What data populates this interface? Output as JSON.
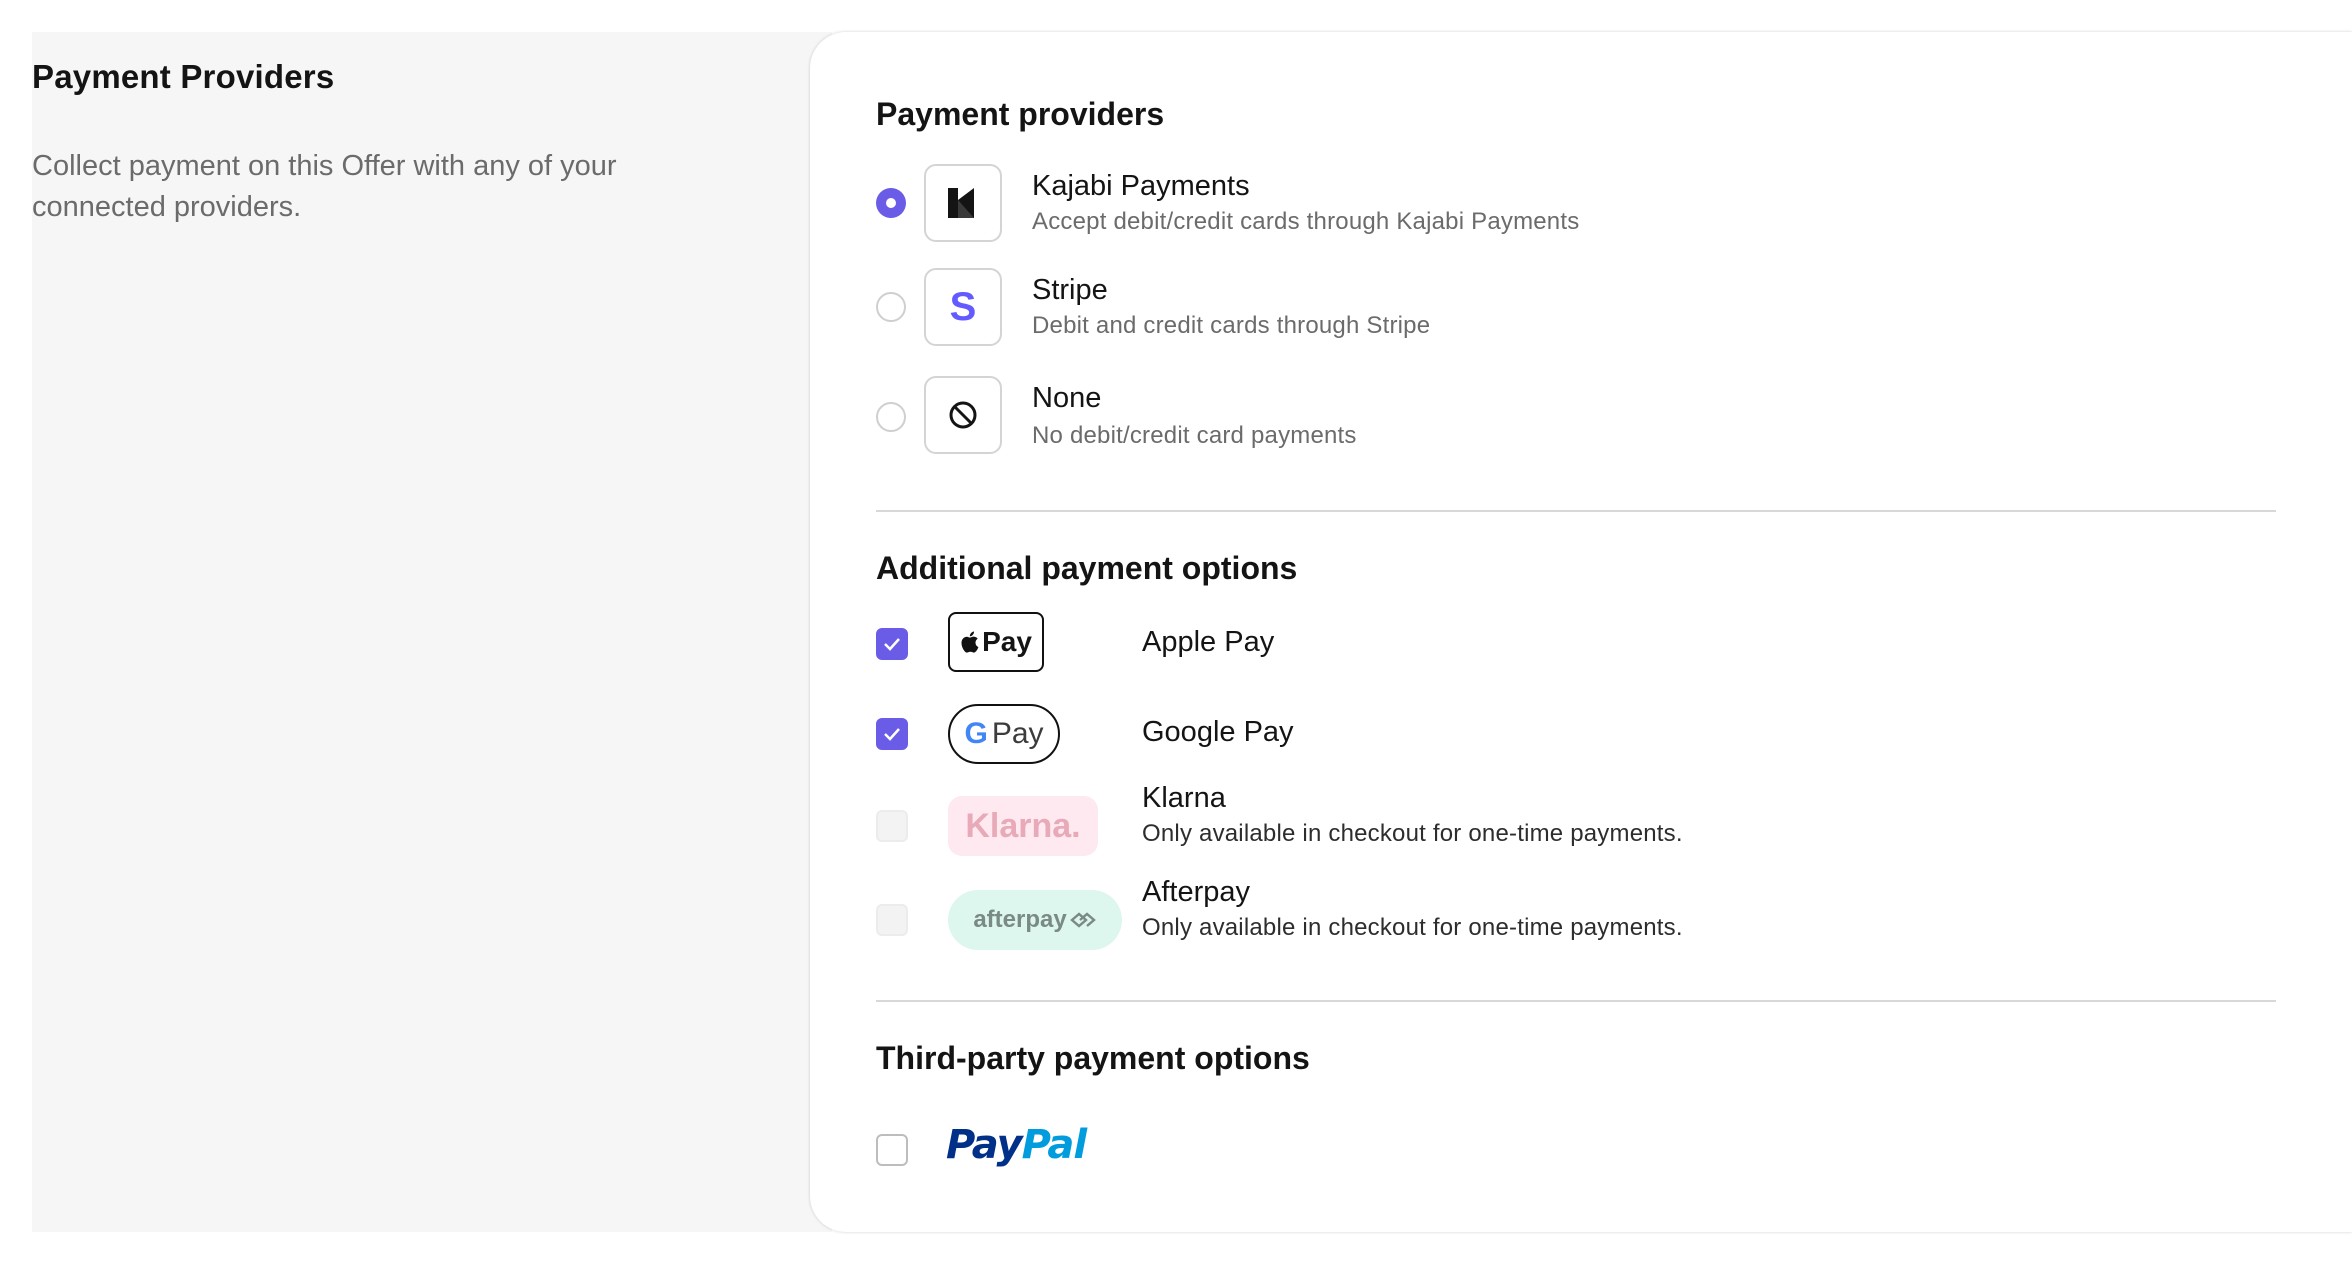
{
  "left": {
    "title": "Payment Providers",
    "description": "Collect payment on this Offer with any of your connected providers."
  },
  "providers": {
    "title": "Payment providers",
    "selected": "kajabi",
    "items": [
      {
        "id": "kajabi",
        "name": "Kajabi Payments",
        "description": "Accept debit/credit cards through Kajabi Payments",
        "icon": "kajabi-logo-icon"
      },
      {
        "id": "stripe",
        "name": "Stripe",
        "description": "Debit and credit cards through Stripe",
        "icon": "stripe-logo-icon",
        "icon_glyph": "S"
      },
      {
        "id": "none",
        "name": "None",
        "description": "No debit/credit card payments",
        "icon": "prohibited-icon"
      }
    ]
  },
  "additional": {
    "title": "Additional payment options",
    "items": [
      {
        "id": "apple-pay",
        "name": "Apple Pay",
        "checked": true,
        "enabled": true,
        "badge_text": "Pay",
        "icon": "apple-icon"
      },
      {
        "id": "google-pay",
        "name": "Google Pay",
        "checked": true,
        "enabled": true,
        "badge_g": "G",
        "badge_text": "Pay"
      },
      {
        "id": "klarna",
        "name": "Klarna",
        "checked": false,
        "enabled": false,
        "badge_text": "Klarna.",
        "note": "Only available in checkout for one-time payments."
      },
      {
        "id": "afterpay",
        "name": "Afterpay",
        "checked": false,
        "enabled": false,
        "badge_text": "afterpay",
        "note": "Only available in checkout for one-time payments."
      }
    ]
  },
  "third_party": {
    "title": "Third-party payment options",
    "items": [
      {
        "id": "paypal",
        "checked": false,
        "logo_pay": "Pay",
        "logo_pal": "Pal"
      }
    ]
  },
  "colors": {
    "accent": "#6b5ce7",
    "stripe": "#635bff",
    "paypal_dark": "#003087",
    "paypal_light": "#009cde"
  }
}
